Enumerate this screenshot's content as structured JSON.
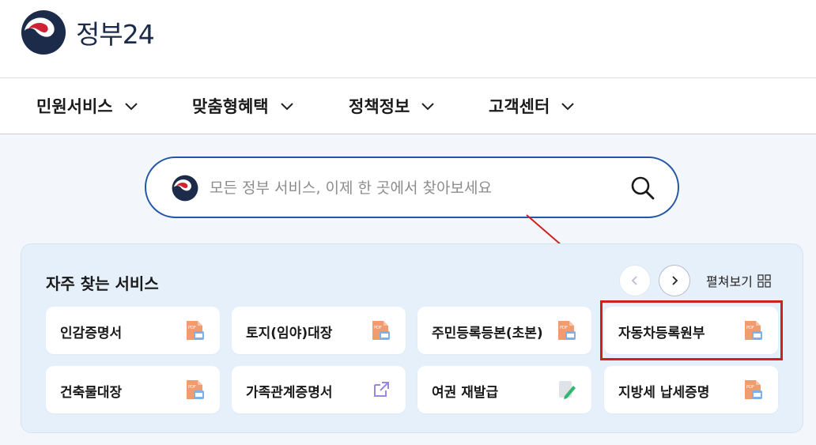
{
  "logo": {
    "text": "정부24"
  },
  "nav": {
    "items": [
      {
        "label": "민원서비스"
      },
      {
        "label": "맞춤형혜택"
      },
      {
        "label": "정책정보"
      },
      {
        "label": "고객센터"
      }
    ]
  },
  "search": {
    "placeholder": "모든 정부 서비스, 이제 한 곳에서 찾아보세요",
    "value": ""
  },
  "frequent": {
    "title": "자주 찾는 서비스",
    "expand_label": "펼쳐보기",
    "cards": [
      {
        "label": "인감증명서",
        "icon": "pdf-doc-icon"
      },
      {
        "label": "토지(임야)대장",
        "icon": "pdf-doc-icon"
      },
      {
        "label": "주민등록등본(초본)",
        "icon": "pdf-doc-icon"
      },
      {
        "label": "자동차등록원부",
        "icon": "pdf-doc-icon"
      },
      {
        "label": "건축물대장",
        "icon": "pdf-doc-icon"
      },
      {
        "label": "가족관계증명서",
        "icon": "external-link-icon"
      },
      {
        "label": "여권 재발급",
        "icon": "edit-form-icon"
      },
      {
        "label": "지방세 납세증명",
        "icon": "pdf-doc-icon"
      }
    ]
  },
  "colors": {
    "accent_blue": "#2456a6",
    "annotation_red": "#d0201e",
    "panel_bg": "#e6f0fb"
  }
}
